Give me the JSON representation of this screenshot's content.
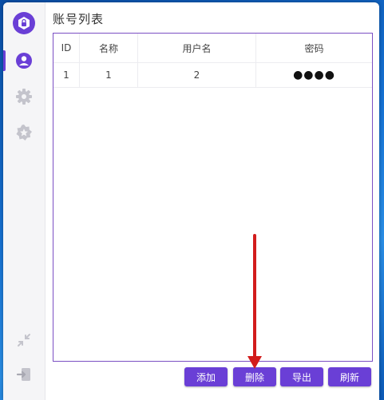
{
  "window": {
    "title": "账号列表"
  },
  "sidebar": {
    "items": [
      {
        "id": "accounts",
        "icon": "user-circle-icon",
        "active": true
      },
      {
        "id": "settings",
        "icon": "gear-icon",
        "active": false
      },
      {
        "id": "favorites",
        "icon": "star-badge-icon",
        "active": false
      }
    ],
    "bottom": [
      {
        "id": "collapse",
        "icon": "collapse-icon"
      },
      {
        "id": "logout",
        "icon": "logout-icon"
      }
    ]
  },
  "table": {
    "headers": [
      "ID",
      "名称",
      "用户名",
      "密码"
    ],
    "rows": [
      {
        "id": "1",
        "name": "1",
        "username": "2",
        "password": "●●●●"
      }
    ]
  },
  "toolbar": {
    "add_label": "添加",
    "delete_label": "删除",
    "export_label": "导出",
    "refresh_label": "刷新"
  },
  "colors": {
    "accent": "#6a3fd6",
    "annotation_arrow": "#d21c1c"
  }
}
